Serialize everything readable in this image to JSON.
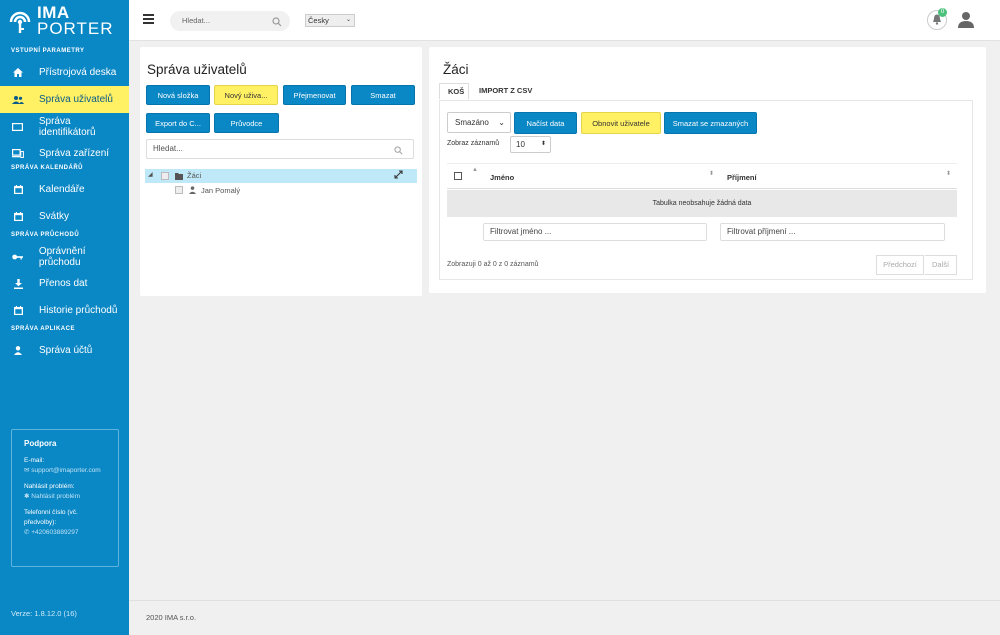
{
  "logo": {
    "line1": "IMA",
    "line2": "PORTER"
  },
  "sidebar": {
    "sections": [
      {
        "title": "VSTUPNÍ PARAMETRY",
        "items": [
          {
            "label": "Přístrojová deska",
            "icon": "home-icon"
          },
          {
            "label": "Správa uživatelů",
            "icon": "users-icon",
            "active": true
          },
          {
            "label": "Správa identifikátorů",
            "icon": "card-icon"
          },
          {
            "label": "Správa zařízení",
            "icon": "devices-icon"
          }
        ]
      },
      {
        "title": "SPRÁVA KALENDÁŘŮ",
        "items": [
          {
            "label": "Kalendáře",
            "icon": "calendar-icon"
          },
          {
            "label": "Svátky",
            "icon": "calendar-icon"
          }
        ]
      },
      {
        "title": "SPRÁVA PRŮCHODŮ",
        "items": [
          {
            "label": "Oprávnění průchodu",
            "icon": "key-icon"
          },
          {
            "label": "Přenos dat",
            "icon": "download-icon"
          },
          {
            "label": "Historie průchodů",
            "icon": "calendar-icon"
          }
        ]
      },
      {
        "title": "SPRÁVA APLIKACE",
        "items": [
          {
            "label": "Správa účtů",
            "icon": "user-icon"
          }
        ]
      }
    ],
    "support": {
      "title": "Podpora",
      "email_label": "E-mail:",
      "email": "support@imaporter.com",
      "report_label": "Nahlásit problém:",
      "report_link": "Nahlásit problém",
      "phone_label": "Telefonní číslo (vč. předvolby):",
      "phone": "+420603889297"
    },
    "version": "Verze: 1.8.12.0 (16)"
  },
  "topbar": {
    "search_placeholder": "Hledat...",
    "language": "Česky",
    "notifications_count": "0"
  },
  "users_panel": {
    "title": "Správa uživatelů",
    "buttons": {
      "new_folder": "Nová složka",
      "new_user": "Nový uživa...",
      "rename": "Přejmenovat",
      "delete": "Smazat",
      "export": "Export do C...",
      "wizard": "Průvodce"
    },
    "search_placeholder": "Hledat...",
    "tree": {
      "folder": "Žáci",
      "child": "Jan Pomalý"
    }
  },
  "students_panel": {
    "title": "Žáci",
    "tabs": [
      "KOŠ",
      "IMPORT Z CSV"
    ],
    "filter_select": "Smazáno",
    "buttons": {
      "load": "Načíst data",
      "restore": "Obnovit uživatele",
      "delete_deleted": "Smazat se zmazaných"
    },
    "page_size_label": "Zobraz záznamů",
    "page_size": "10",
    "columns": [
      "Jméno",
      "Příjmení"
    ],
    "empty": "Tabulka neobsahuje žádná data",
    "filter_name_placeholder": "Filtrovat jméno ...",
    "filter_surname_placeholder": "Filtrovat příjmení ...",
    "info": "Zobrazuji 0 až 0 z 0 záznamů",
    "prev": "Předchozí",
    "next": "Další"
  },
  "footer": "2020 IMA s.r.o."
}
